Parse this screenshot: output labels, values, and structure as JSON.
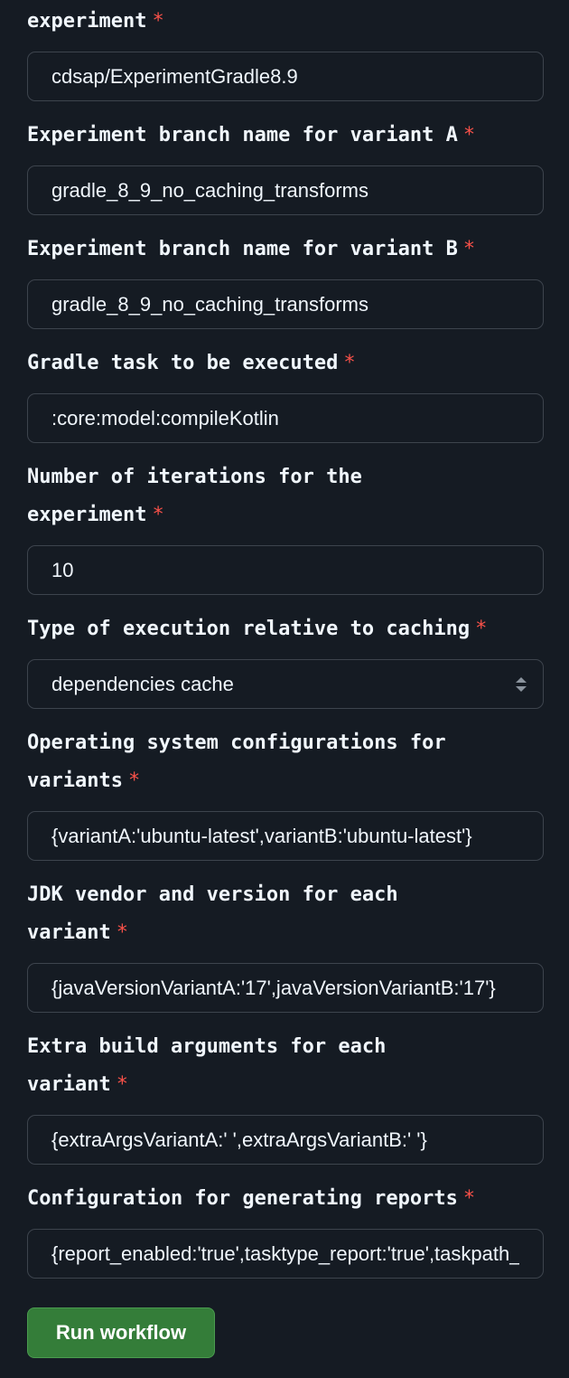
{
  "fields": [
    {
      "label_lines": [
        "experiment"
      ],
      "value": "cdsap/ExperimentGradle8.9"
    },
    {
      "label_lines": [
        "Experiment branch name for variant A"
      ],
      "value": "gradle_8_9_no_caching_transforms"
    },
    {
      "label_lines": [
        "Experiment branch name for variant B"
      ],
      "value": "gradle_8_9_no_caching_transforms"
    },
    {
      "label_lines": [
        "Gradle task to be executed"
      ],
      "value": ":core:model:compileKotlin"
    },
    {
      "label_lines": [
        "Number of iterations for the",
        "experiment"
      ],
      "value": "10"
    },
    {
      "label_lines": [
        "Type of execution relative to caching"
      ],
      "value": "dependencies cache",
      "type": "select"
    },
    {
      "label_lines": [
        "Operating system configurations for",
        "variants"
      ],
      "value": "{variantA:'ubuntu-latest',variantB:'ubuntu-latest'}"
    },
    {
      "label_lines": [
        "JDK vendor and version for each",
        "variant"
      ],
      "value": "{javaVersionVariantA:'17',javaVersionVariantB:'17'}"
    },
    {
      "label_lines": [
        "Extra build arguments for each",
        "variant"
      ],
      "value": "{extraArgsVariantA:' ',extraArgsVariantB:' '}"
    },
    {
      "label_lines": [
        "Configuration for generating reports"
      ],
      "value": "{report_enabled:'true',tasktype_report:'true',taskpath_report:'true'}"
    }
  ],
  "required_marker": "*",
  "run_button_label": "Run workflow",
  "colors": {
    "background": "#151b23",
    "text": "#f0f6fc",
    "required": "#f85149",
    "border": "#3d444d",
    "button": "#347d39"
  }
}
